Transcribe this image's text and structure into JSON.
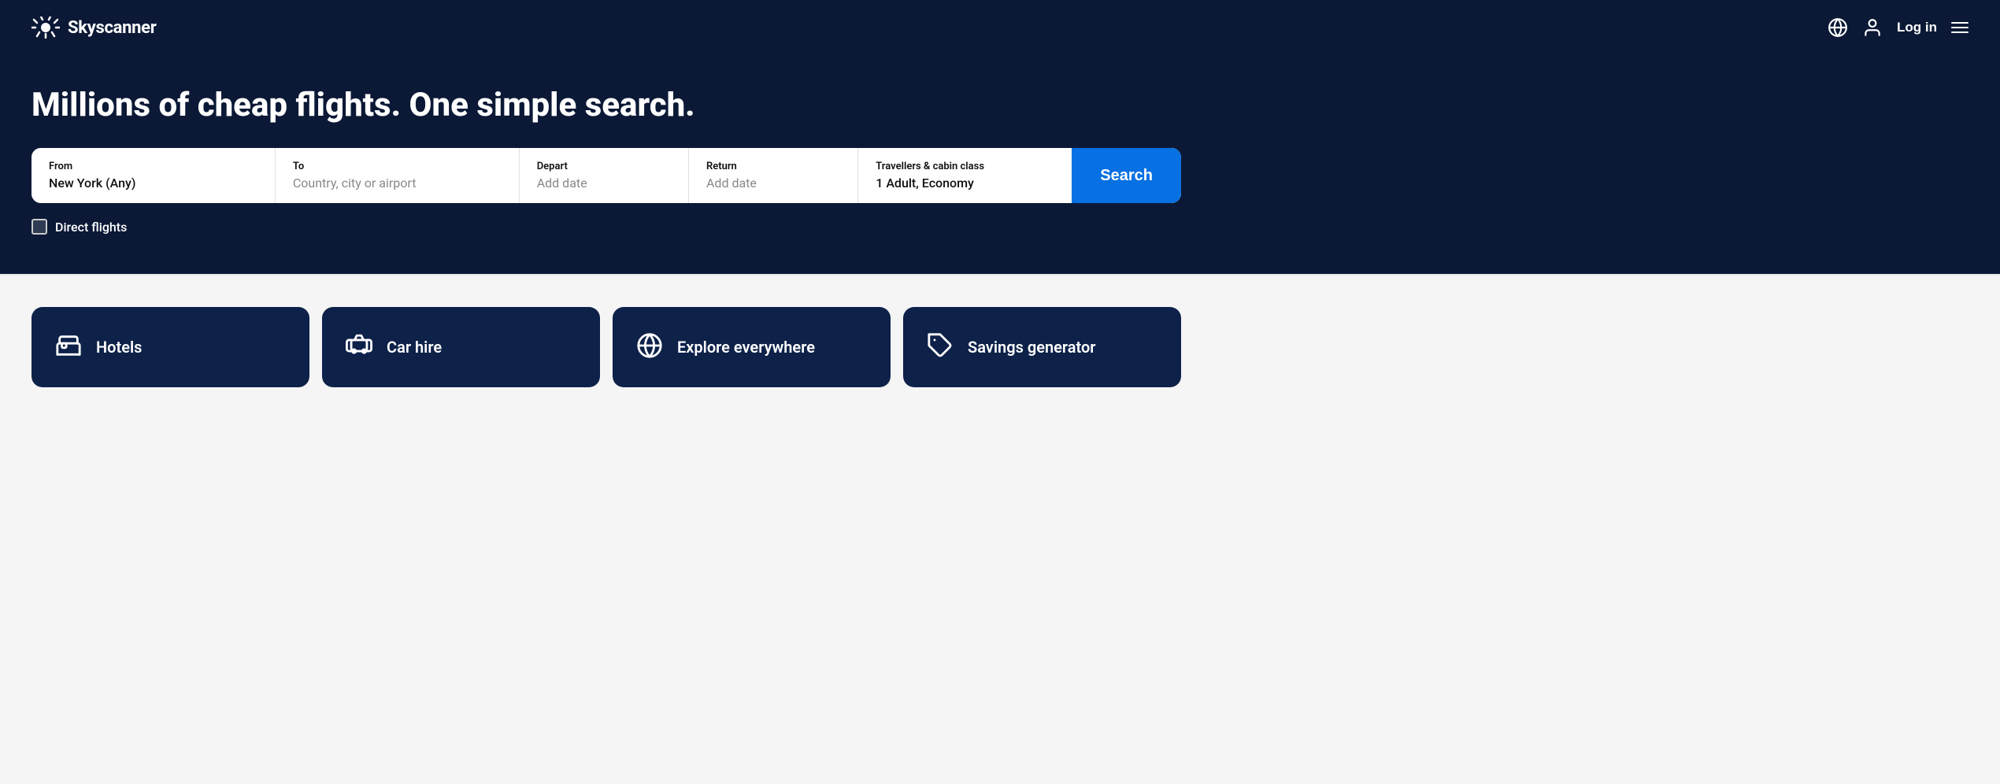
{
  "header": {
    "logo_text": "Skyscanner",
    "login_label": "Log in"
  },
  "hero": {
    "title": "Millions of cheap flights. One simple search.",
    "search": {
      "from_label": "From",
      "from_value": "New York (Any)",
      "to_label": "To",
      "to_placeholder": "Country, city or airport",
      "depart_label": "Depart",
      "depart_placeholder": "Add date",
      "return_label": "Return",
      "return_placeholder": "Add date",
      "travellers_label": "Travellers & cabin class",
      "travellers_value": "1 Adult, Economy",
      "search_btn_label": "Search"
    },
    "direct_flights_label": "Direct flights"
  },
  "cards": [
    {
      "id": "hotels",
      "label": "Hotels",
      "icon": "bed"
    },
    {
      "id": "car-hire",
      "label": "Car hire",
      "icon": "car"
    },
    {
      "id": "explore",
      "label": "Explore everywhere",
      "icon": "globe"
    },
    {
      "id": "savings",
      "label": "Savings generator",
      "icon": "tag"
    }
  ]
}
